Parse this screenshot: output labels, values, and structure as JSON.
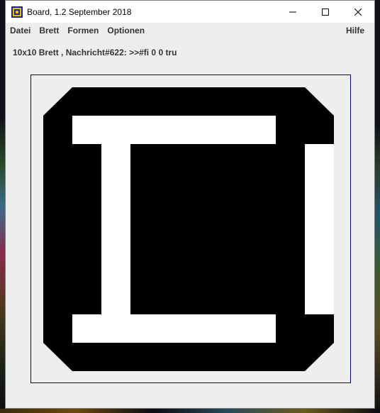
{
  "window": {
    "title": "Board, 1.2 September 2018",
    "icon": "board-app-icon",
    "controls": {
      "minimize": "minimize-icon",
      "maximize": "maximize-icon",
      "close": "close-icon"
    }
  },
  "menu": {
    "items": [
      "Datei",
      "Brett",
      "Formen",
      "Optionen"
    ],
    "help": "Hilfe"
  },
  "status_text": "10x10 Brett , Nachricht#622: >>#fi 0 0 tru",
  "board": {
    "size": 10,
    "colors": {
      "filled": "#000000",
      "empty": "#ffffff",
      "frame": "#00008b",
      "window_bg": "#eeeeee"
    },
    "cells": [
      [
        0,
        1,
        1,
        1,
        1,
        1,
        1,
        1,
        1,
        0
      ],
      [
        1,
        0,
        0,
        0,
        0,
        0,
        0,
        0,
        1,
        1
      ],
      [
        1,
        1,
        0,
        1,
        1,
        1,
        1,
        1,
        1,
        0
      ],
      [
        1,
        1,
        0,
        1,
        1,
        1,
        1,
        1,
        1,
        0
      ],
      [
        1,
        1,
        0,
        1,
        1,
        1,
        1,
        1,
        1,
        0
      ],
      [
        1,
        1,
        0,
        1,
        1,
        1,
        1,
        1,
        1,
        0
      ],
      [
        1,
        1,
        0,
        1,
        1,
        1,
        1,
        1,
        1,
        0
      ],
      [
        1,
        1,
        0,
        1,
        1,
        1,
        1,
        1,
        1,
        0
      ],
      [
        1,
        0,
        0,
        0,
        0,
        0,
        0,
        0,
        1,
        1
      ],
      [
        0,
        1,
        1,
        1,
        1,
        1,
        1,
        1,
        1,
        0
      ]
    ],
    "corners_beveled": [
      "top-left",
      "top-right",
      "bottom-left",
      "bottom-right"
    ]
  }
}
